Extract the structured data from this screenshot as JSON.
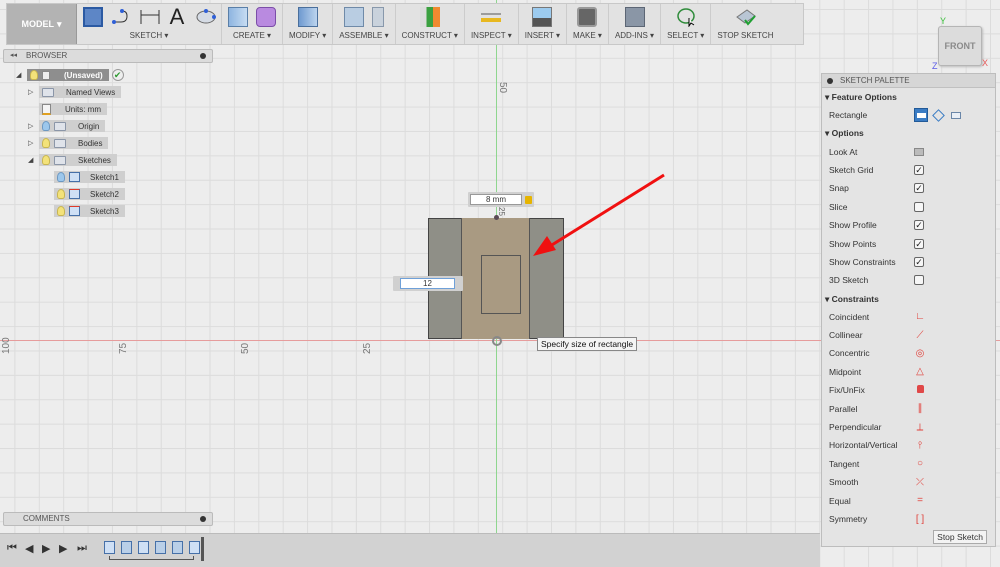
{
  "toolbar": {
    "model_label": "MODEL",
    "groups": [
      {
        "label": "SKETCH",
        "icons": [
          "create-sketch-icon",
          "spline-icon",
          "dimension-icon",
          "text-icon",
          "ellipse-icon"
        ]
      },
      {
        "label": "CREATE",
        "icons": [
          "extrude-icon",
          "form-icon"
        ]
      },
      {
        "label": "MODIFY",
        "icons": [
          "press-pull-icon"
        ]
      },
      {
        "label": "ASSEMBLE",
        "icons": [
          "new-component-icon",
          "joint-icon"
        ]
      },
      {
        "label": "CONSTRUCT",
        "icons": [
          "offset-plane-icon"
        ]
      },
      {
        "label": "INSPECT",
        "icons": [
          "measure-icon"
        ]
      },
      {
        "label": "INSERT",
        "icons": [
          "insert-image-icon"
        ]
      },
      {
        "label": "MAKE",
        "icons": [
          "3d-print-icon"
        ]
      },
      {
        "label": "ADD-INS",
        "icons": [
          "scripts-icon"
        ]
      },
      {
        "label": "SELECT",
        "icons": [
          "lasso-select-icon"
        ]
      },
      {
        "label": "STOP SKETCH",
        "icons": [
          "stop-sketch-icon"
        ]
      }
    ]
  },
  "browser": {
    "title": "BROWSER",
    "items": [
      {
        "label": "(Unsaved)",
        "level": 0
      },
      {
        "label": "Named Views",
        "level": 1
      },
      {
        "label": "Units: mm",
        "level": 1
      },
      {
        "label": "Origin",
        "level": 1
      },
      {
        "label": "Bodies",
        "level": 1
      },
      {
        "label": "Sketches",
        "level": 1
      },
      {
        "label": "Sketch1",
        "level": 2
      },
      {
        "label": "Sketch2",
        "level": 2
      },
      {
        "label": "Sketch3",
        "level": 2
      }
    ]
  },
  "comments": {
    "title": "COMMENTS"
  },
  "viewcube": {
    "face": "FRONT",
    "axis_x": "X",
    "axis_y": "Y",
    "axis_z": "Z"
  },
  "canvas": {
    "h_ticks": [
      "100",
      "75",
      "50",
      "25"
    ],
    "v_tick": "50",
    "width_dim": "8 mm",
    "height_dim": "12",
    "small_dim": "25",
    "tooltip": "Specify size of rectangle"
  },
  "palette": {
    "title": "SKETCH PALETTE",
    "feature_options": {
      "label": "Feature Options",
      "rectangle_label": "Rectangle"
    },
    "options": {
      "label": "Options",
      "items": [
        {
          "label": "Look At",
          "type": "button"
        },
        {
          "label": "Sketch Grid",
          "checked": true
        },
        {
          "label": "Snap",
          "checked": true
        },
        {
          "label": "Slice",
          "checked": false
        },
        {
          "label": "Show Profile",
          "checked": true
        },
        {
          "label": "Show Points",
          "checked": true
        },
        {
          "label": "Show Constraints",
          "checked": true
        },
        {
          "label": "3D Sketch",
          "checked": false
        }
      ]
    },
    "constraints": {
      "label": "Constraints",
      "items": [
        {
          "label": "Coincident",
          "glyph": "∟"
        },
        {
          "label": "Collinear",
          "glyph": "⟋"
        },
        {
          "label": "Concentric",
          "glyph": "◎"
        },
        {
          "label": "Midpoint",
          "glyph": "△"
        },
        {
          "label": "Fix/UnFix",
          "glyph": "🔒"
        },
        {
          "label": "Parallel",
          "glyph": "∥"
        },
        {
          "label": "Perpendicular",
          "glyph": "⟂"
        },
        {
          "label": "Horizontal/Vertical",
          "glyph": "⫯"
        },
        {
          "label": "Tangent",
          "glyph": "○"
        },
        {
          "label": "Smooth",
          "glyph": "⤫"
        },
        {
          "label": "Equal",
          "glyph": "="
        },
        {
          "label": "Symmetry",
          "glyph": "[ ]"
        }
      ]
    },
    "stop_sketch_label": "Stop Sketch"
  },
  "timeline": {
    "steps": [
      "sketch",
      "extrude",
      "sketch",
      "extrude",
      "extrude",
      "sketch"
    ]
  }
}
